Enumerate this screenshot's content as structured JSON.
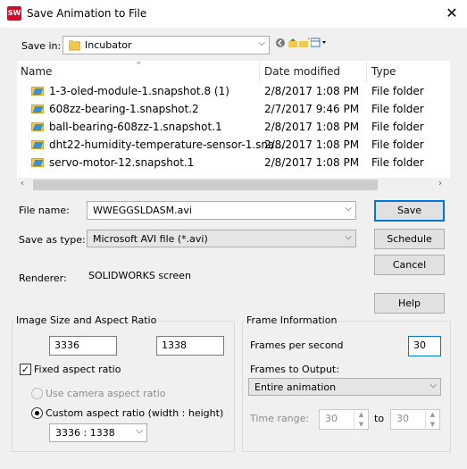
{
  "window": {
    "title": "Save Animation to File",
    "app_icon_text": "SW"
  },
  "save_in": {
    "label": "Save in:",
    "value": "Incubator"
  },
  "file_list": {
    "headers": {
      "name": "Name",
      "date": "Date modified",
      "type": "Type"
    },
    "rows": [
      {
        "name": "1-3-oled-module-1.snapshot.8 (1)",
        "date": "2/8/2017 1:08 PM",
        "type": "File folder"
      },
      {
        "name": "608zz-bearing-1.snapshot.2",
        "date": "2/7/2017 9:46 PM",
        "type": "File folder"
      },
      {
        "name": "ball-bearing-608zz-1.snapshot.1",
        "date": "2/8/2017 1:08 PM",
        "type": "File folder"
      },
      {
        "name": "dht22-humidity-temperature-sensor-1.sna...",
        "date": "2/8/2017 1:08 PM",
        "type": "File folder"
      },
      {
        "name": "servo-motor-12.snapshot.1",
        "date": "2/8/2017 1:08 PM",
        "type": "File folder"
      }
    ]
  },
  "file_name": {
    "label": "File name:",
    "value": "WWEGGSLDASM.avi"
  },
  "save_as_type": {
    "label": "Save as type:",
    "value": "Microsoft AVI file (*.avi)"
  },
  "renderer": {
    "label": "Renderer:",
    "value": "SOLIDWORKS screen"
  },
  "buttons": {
    "save": "Save",
    "schedule": "Schedule",
    "cancel": "Cancel",
    "help": "Help"
  },
  "image_size": {
    "title": "Image Size and Aspect Ratio",
    "width": "3336",
    "height": "1338",
    "fixed_aspect_label": "Fixed aspect ratio",
    "fixed_aspect_checked": true,
    "camera_aspect_label": "Use camera aspect ratio",
    "custom_aspect_label": "Custom aspect ratio (width : height)",
    "custom_aspect_value": "3336 : 1338"
  },
  "frame_info": {
    "title": "Frame Information",
    "fps_label": "Frames per second",
    "fps_value": "30",
    "frames_output_label": "Frames to Output:",
    "frames_output_value": "Entire animation",
    "time_range_label": "Time range:",
    "time_from": "30",
    "time_to_label": "to",
    "time_to": "30"
  }
}
